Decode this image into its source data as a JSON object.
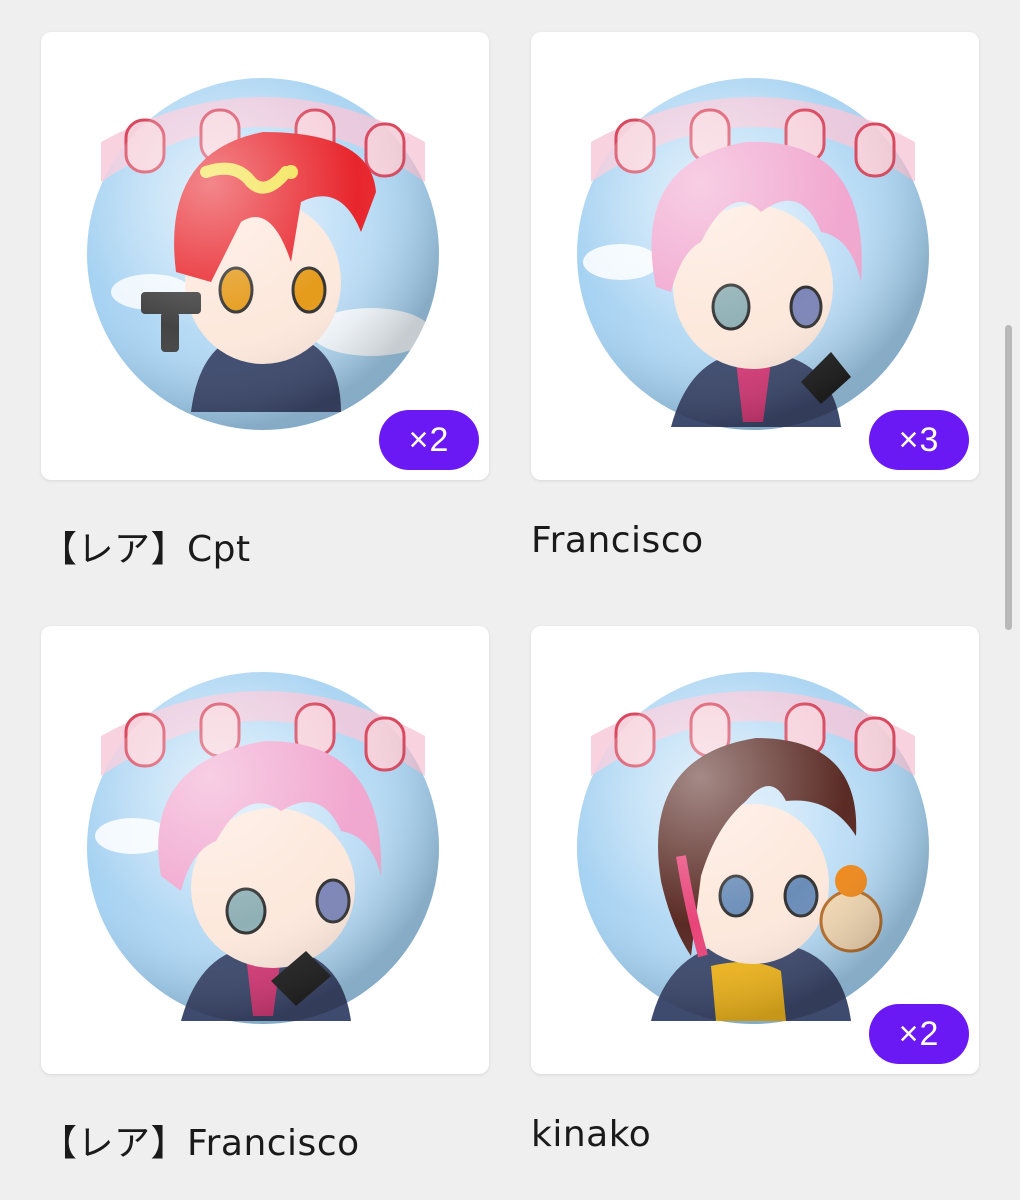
{
  "accent_color": "#6a19f5",
  "items": [
    {
      "name": "【レア】Cpt",
      "count": "×2",
      "hair": "#e8252c",
      "eyes": "#e59b1b",
      "has_count": true
    },
    {
      "name": "Francisco",
      "count": "×3",
      "hair": "#f1a7cf",
      "eyes": "#8fb0b5",
      "has_count": true
    },
    {
      "name": "【レア】Francisco",
      "count": "",
      "hair": "#f1a7cf",
      "eyes": "#8fb0b5",
      "has_count": false
    },
    {
      "name": "kinako",
      "count": "×2",
      "hair": "#5a2a24",
      "eyes": "#6a8db8",
      "has_count": true
    }
  ]
}
